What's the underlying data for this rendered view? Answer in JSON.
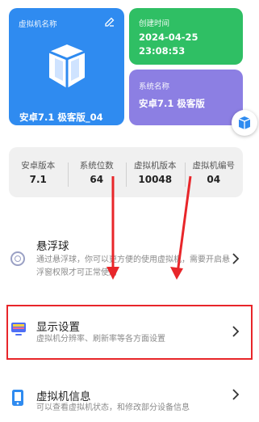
{
  "vm_card": {
    "label": "虚拟机名称",
    "name": "安卓7.1 极客版_04"
  },
  "created_card": {
    "label": "创建时间",
    "date": "2024-04-25",
    "time": "23:08:53"
  },
  "system_card": {
    "label": "系统名称",
    "name": "安卓7.1 极客版"
  },
  "info": [
    {
      "label": "安卓版本",
      "value": "7.1"
    },
    {
      "label": "系统位数",
      "value": "64"
    },
    {
      "label": "虚拟机版本",
      "value": "10048"
    },
    {
      "label": "虚拟机编号",
      "value": "04"
    }
  ],
  "settings": [
    {
      "title": "悬浮球",
      "desc": "通过悬浮球，你可以更方便的使用虚拟机，需要开启悬浮窗权限才可正常使用"
    },
    {
      "title": "显示设置",
      "desc": "虚拟机分辨率、刷新率等各方面设置"
    },
    {
      "title": "虚拟机信息",
      "desc": "可以查看虚拟机状态，和修改部分设备信息"
    }
  ],
  "colors": {
    "blue": "#2f8bf0",
    "green": "#2fbf64",
    "purple": "#8c7fe3",
    "annotation_red": "#e8262a"
  }
}
